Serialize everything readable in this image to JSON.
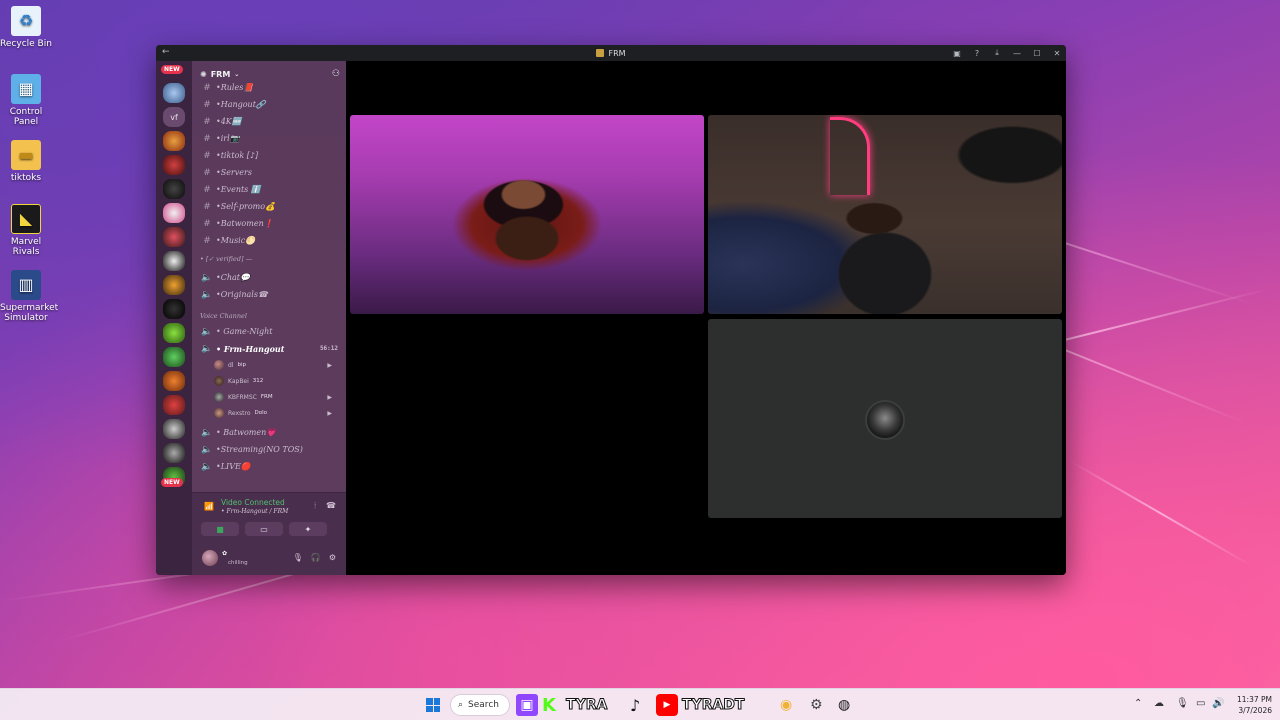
{
  "desktop": {
    "icons": [
      {
        "label": "Recycle Bin",
        "icon": "recycle-bin-icon"
      },
      {
        "label": "Control Panel",
        "icon": "control-panel-icon"
      },
      {
        "label": "tiktoks",
        "icon": "folder-icon"
      },
      {
        "label": "Marvel Rivals",
        "icon": "marvel-rivals-icon"
      },
      {
        "label": "Supermarket Simulator",
        "icon": "supermarket-simulator-icon"
      }
    ]
  },
  "window": {
    "title": "FRM",
    "server_name": "FRM",
    "new_badge": "NEW",
    "channels": [
      {
        "name": "•Rules📕",
        "type": "text"
      },
      {
        "name": "•Hangout🔗",
        "type": "text"
      },
      {
        "name": "•4K🆕",
        "type": "text"
      },
      {
        "name": "•irl📷",
        "type": "text"
      },
      {
        "name": "•tiktok [♪]",
        "type": "text"
      },
      {
        "name": "•Servers",
        "type": "text"
      },
      {
        "name": "•Events ℹ️",
        "type": "text"
      },
      {
        "name": "•Self-promo💰",
        "type": "text"
      },
      {
        "name": "•Batwomen❗",
        "type": "text"
      },
      {
        "name": "•Music🌕",
        "type": "text"
      }
    ],
    "verified_category": "• [✓ verified] —",
    "channels2": [
      {
        "name": "•Chat💬",
        "type": "voice"
      },
      {
        "name": "•Originals☎",
        "type": "voice"
      }
    ],
    "voice_category": "Voice Channel",
    "voice_channels": [
      {
        "name": "• Game-Night",
        "type": "voice"
      },
      {
        "name": "• Frm-Hangout",
        "type": "voice",
        "active": true,
        "timer": "56:12"
      }
    ],
    "voice_users": [
      {
        "name": "dl",
        "tag": "bip"
      },
      {
        "name": "KapBei",
        "tag": "312"
      },
      {
        "name": "KBFRMSC",
        "tag": "FRM"
      },
      {
        "name": "Rexstro",
        "tag": "Dolo"
      }
    ],
    "voice_channels2": [
      {
        "name": "• Batwomen💗",
        "type": "voice"
      },
      {
        "name": "•Streaming(NO TOS)",
        "type": "voice"
      },
      {
        "name": "•LIVE🔴",
        "type": "voice"
      }
    ],
    "voice_panel": {
      "status": "Video Connected",
      "location": "• Frm-Hangout / FRM",
      "user_status": "chilling"
    }
  },
  "taskbar": {
    "search_label": "Search",
    "apps": [
      "TYRA",
      "TYRADT"
    ],
    "time": "11:37 PM",
    "date": "3/7/2026"
  },
  "colors": {
    "voice_connected": "#4ec06e",
    "new_badge": "#e6334d",
    "neon": "#ff3d7f"
  }
}
